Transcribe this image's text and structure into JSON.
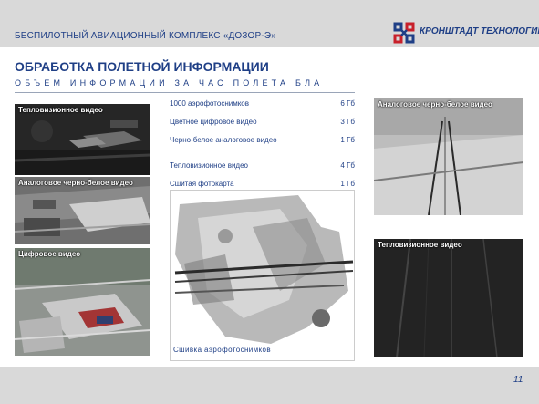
{
  "header": {
    "complex_title": "БЕСПИЛОТНЫЙ АВИАЦИОННЫЙ КОМПЛЕКС «ДОЗОР-Э»",
    "logo_text": "КРОНШТАДТ ТЕХНОЛОГИИ",
    "logo_icon": "kronshtadt-logo-icon",
    "brand_color": "#1f3f86",
    "accent_color": "#c8202a"
  },
  "slide": {
    "title": "ОБРАБОТКА ПОЛЕТНОЙ ИНФОРМАЦИИ",
    "subtitle": "ОБЪЕМ ИНФОРМАЦИИ ЗА ЧАС ПОЛЕТА БЛА"
  },
  "panels": {
    "thermal_left": "Тепловизионное видео",
    "analog_left": "Аналоговое черно-белое видео",
    "digital_left": "Цифровое видео",
    "analog_right": "Аналоговое черно-белое видео",
    "thermal_right": "Тепловизионное видео"
  },
  "stats": [
    {
      "name": "1000 аэрофотоснимков",
      "value": "6 Гб"
    },
    {
      "name": "Цветное цифровое видео",
      "value": "3 Гб"
    },
    {
      "name": "Черно-белое аналоговое видео",
      "value": "1 Гб"
    },
    {
      "name": "Тепловизионное видео",
      "value": "4 Гб"
    },
    {
      "name": "Сшитая фотокарта",
      "value": "1 Гб"
    }
  ],
  "mosaic_caption": "Сшивка аэрофотоснимков",
  "footer": {
    "page_number": "11"
  }
}
